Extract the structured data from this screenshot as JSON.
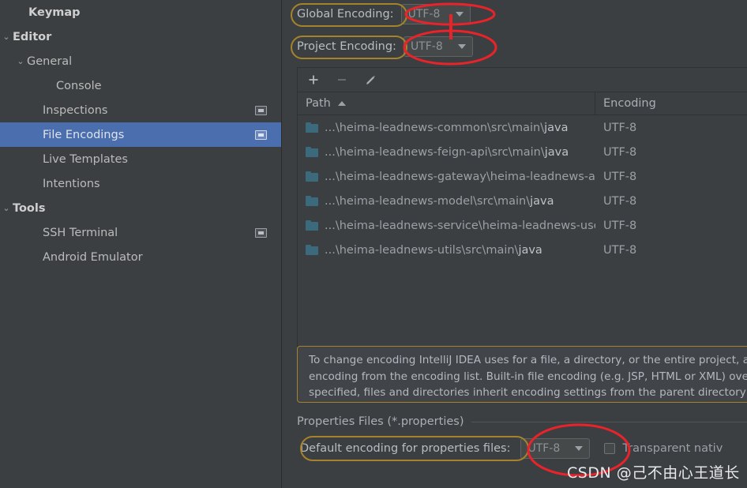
{
  "sidebar": {
    "items": [
      {
        "label": "Keymap",
        "indent": 20,
        "bold": true,
        "twisty": "",
        "selected": false,
        "icon": false
      },
      {
        "label": "Editor",
        "indent": 0,
        "bold": true,
        "twisty": "⌄",
        "selected": false,
        "icon": false
      },
      {
        "label": "General",
        "indent": 18,
        "bold": false,
        "twisty": "⌄",
        "selected": false,
        "icon": false
      },
      {
        "label": "Console",
        "indent": 55,
        "bold": false,
        "twisty": "",
        "selected": false,
        "icon": false
      },
      {
        "label": "Inspections",
        "indent": 38,
        "bold": false,
        "twisty": "",
        "selected": false,
        "icon": true
      },
      {
        "label": "File Encodings",
        "indent": 38,
        "bold": false,
        "twisty": "",
        "selected": true,
        "icon": true
      },
      {
        "label": "Live Templates",
        "indent": 38,
        "bold": false,
        "twisty": "",
        "selected": false,
        "icon": false
      },
      {
        "label": "Intentions",
        "indent": 38,
        "bold": false,
        "twisty": "",
        "selected": false,
        "icon": false
      },
      {
        "label": "Tools",
        "indent": 0,
        "bold": true,
        "twisty": "⌄",
        "selected": false,
        "icon": false
      },
      {
        "label": "SSH Terminal",
        "indent": 38,
        "bold": false,
        "twisty": "",
        "selected": false,
        "icon": true
      },
      {
        "label": "Android Emulator",
        "indent": 38,
        "bold": false,
        "twisty": "",
        "selected": false,
        "icon": false
      }
    ]
  },
  "main": {
    "global_encoding": {
      "label": "Global Encoding:",
      "value": "UTF-8"
    },
    "project_encoding": {
      "label": "Project Encoding:",
      "value": "UTF-8"
    },
    "toolbar": {
      "add_label": "+",
      "remove_label": "−",
      "edit_label": "edit"
    },
    "table": {
      "columns": [
        "Path",
        "Encoding"
      ],
      "sort_column": "Path",
      "sort_direction": "asc",
      "rows": [
        {
          "path_prefix": "...\\heima-leadnews-common\\src\\main\\",
          "path_highlight": "java",
          "encoding": "UTF-8"
        },
        {
          "path_prefix": "...\\heima-leadnews-feign-api\\src\\main\\",
          "path_highlight": "java",
          "encoding": "UTF-8"
        },
        {
          "path_prefix": "...\\heima-leadnews-gateway\\heima-leadnews-a",
          "path_highlight": "",
          "encoding": "UTF-8"
        },
        {
          "path_prefix": "...\\heima-leadnews-model\\src\\main\\",
          "path_highlight": "java",
          "encoding": "UTF-8"
        },
        {
          "path_prefix": "...\\heima-leadnews-service\\heima-leadnews-use",
          "path_highlight": "",
          "encoding": "UTF-8"
        },
        {
          "path_prefix": "...\\heima-leadnews-utils\\src\\main\\",
          "path_highlight": "java",
          "encoding": "UTF-8"
        }
      ]
    },
    "info_text_lines": [
      "To change encoding IntelliJ IDEA uses for a file, a directory, or the entire project, add its p",
      "encoding from the encoding list. Built-in file encoding (e.g. JSP, HTML or XML) overrides",
      "specified, files and directories inherit encoding settings from the parent directory or from"
    ],
    "properties_section": {
      "title": "Properties Files (*.properties)",
      "default_encoding_label": "Default encoding for properties files:",
      "default_encoding_value": "UTF-8",
      "transparent_native_label": "Transparent nativ",
      "transparent_native_checked": false
    }
  },
  "watermark": "CSDN @己不由心王道长",
  "colors": {
    "background": "#3c3f41",
    "selection_blue": "#4b6eaf",
    "annotation_gold": "#a5832a",
    "annotation_red": "#e8232a",
    "folder_teal": "#3b6a7c"
  }
}
